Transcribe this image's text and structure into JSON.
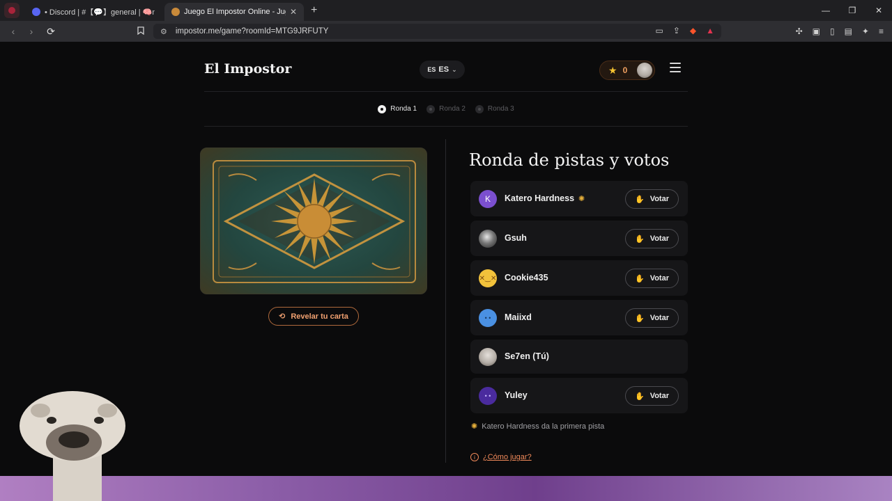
{
  "browser": {
    "tabs": [
      {
        "title": "• Discord | #【💬】general | 🧠n't",
        "active": false
      },
      {
        "title": "Juego El Impostor Online - Jugar",
        "active": true
      }
    ],
    "new_tab": "+",
    "url": "impostor.me/game?roomId=MTG9JRFUTY"
  },
  "header": {
    "logo": "El Impostor",
    "lang_flag": "ES",
    "lang_code": "ES",
    "score": "0"
  },
  "rounds": [
    {
      "label": "Ronda 1",
      "active": true
    },
    {
      "label": "Ronda 2",
      "active": false
    },
    {
      "label": "Ronda 3",
      "active": false
    }
  ],
  "card": {
    "reveal_label": "Revelar tu carta"
  },
  "panel": {
    "title": "Ronda de pistas y votos",
    "vote_label": "Votar",
    "players": [
      {
        "name": "Katero Hardness",
        "avatar": "K",
        "avatar_color": "#7b4fcf",
        "first_clue": true,
        "votable": true
      },
      {
        "name": "Gsuh",
        "avatar": "",
        "avatar_color": "#555555",
        "first_clue": false,
        "votable": true
      },
      {
        "name": "Cookie435",
        "avatar": "",
        "avatar_color": "#f2c23b",
        "first_clue": false,
        "votable": true
      },
      {
        "name": "Maiixd",
        "avatar": "",
        "avatar_color": "#4a90e2",
        "first_clue": false,
        "votable": true
      },
      {
        "name": "Se7en (Tú)",
        "avatar": "",
        "avatar_color": "#b9b2ab",
        "first_clue": false,
        "votable": false
      },
      {
        "name": "Yuley",
        "avatar": "",
        "avatar_color": "#4a2b9e",
        "first_clue": false,
        "votable": true
      }
    ],
    "hint": "Katero Hardness da la primera pista",
    "howto": "¿Cómo jugar?"
  },
  "colors": {
    "accent": "#f08a5a",
    "background": "#0b0b0c",
    "row": "#161618"
  }
}
